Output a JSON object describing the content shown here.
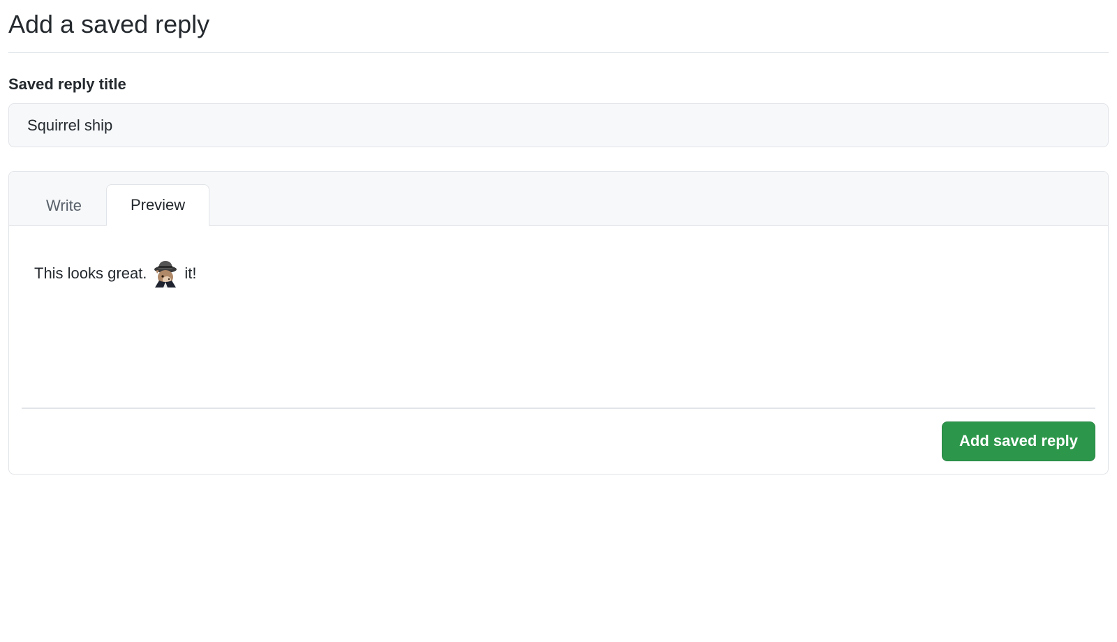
{
  "page": {
    "title": "Add a saved reply"
  },
  "form": {
    "title_label": "Saved reply title",
    "title_value": "Squirrel ship"
  },
  "editor": {
    "tabs": {
      "write": "Write",
      "preview": "Preview",
      "active": "preview"
    },
    "preview": {
      "text_before": "This looks great.",
      "emoji_name": "shipit",
      "text_after": "it!"
    }
  },
  "actions": {
    "submit_label": "Add saved reply"
  }
}
